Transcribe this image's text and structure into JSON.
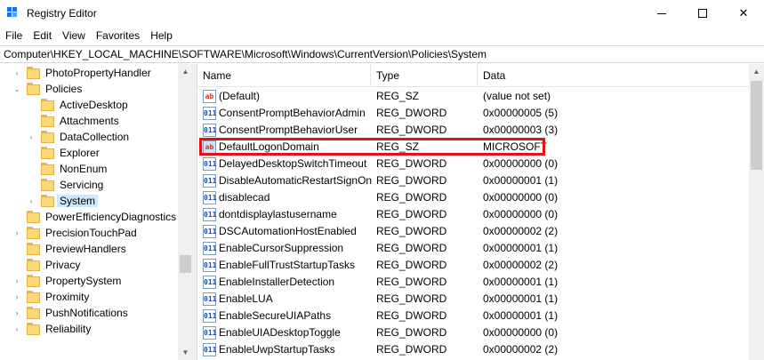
{
  "window": {
    "title": "Registry Editor",
    "minimize_icon": "minimize-icon",
    "maximize_icon": "maximize-icon",
    "close_glyph": "✕"
  },
  "menu": [
    "File",
    "Edit",
    "View",
    "Favorites",
    "Help"
  ],
  "address": "Computer\\HKEY_LOCAL_MACHINE\\SOFTWARE\\Microsoft\\Windows\\CurrentVersion\\Policies\\System",
  "tree": [
    {
      "label": "PhotoPropertyHandler",
      "level": 1,
      "expander": "›",
      "selected": false
    },
    {
      "label": "Policies",
      "level": 1,
      "expander": "⌄",
      "selected": false
    },
    {
      "label": "ActiveDesktop",
      "level": 2,
      "expander": "",
      "selected": false
    },
    {
      "label": "Attachments",
      "level": 2,
      "expander": "",
      "selected": false
    },
    {
      "label": "DataCollection",
      "level": 2,
      "expander": "›",
      "selected": false
    },
    {
      "label": "Explorer",
      "level": 2,
      "expander": "",
      "selected": false
    },
    {
      "label": "NonEnum",
      "level": 2,
      "expander": "",
      "selected": false
    },
    {
      "label": "Servicing",
      "level": 2,
      "expander": "",
      "selected": false
    },
    {
      "label": "System",
      "level": 2,
      "expander": "›",
      "selected": true
    },
    {
      "label": "PowerEfficiencyDiagnostics",
      "level": 1,
      "expander": "",
      "selected": false
    },
    {
      "label": "PrecisionTouchPad",
      "level": 1,
      "expander": "›",
      "selected": false
    },
    {
      "label": "PreviewHandlers",
      "level": 1,
      "expander": "",
      "selected": false
    },
    {
      "label": "Privacy",
      "level": 1,
      "expander": "",
      "selected": false
    },
    {
      "label": "PropertySystem",
      "level": 1,
      "expander": "›",
      "selected": false
    },
    {
      "label": "Proximity",
      "level": 1,
      "expander": "›",
      "selected": false
    },
    {
      "label": "PushNotifications",
      "level": 1,
      "expander": "›",
      "selected": false
    },
    {
      "label": "Reliability",
      "level": 1,
      "expander": "›",
      "selected": false
    }
  ],
  "columns": [
    "Name",
    "Type",
    "Data"
  ],
  "values": [
    {
      "name": "(Default)",
      "type": "REG_SZ",
      "data": "(value not set)",
      "icon": "ab"
    },
    {
      "name": "ConsentPromptBehaviorAdmin",
      "type": "REG_DWORD",
      "data": "0x00000005 (5)",
      "icon": "011"
    },
    {
      "name": "ConsentPromptBehaviorUser",
      "type": "REG_DWORD",
      "data": "0x00000003 (3)",
      "icon": "011"
    },
    {
      "name": "DefaultLogonDomain",
      "type": "REG_SZ",
      "data": "MICROSOFT",
      "icon": "ab",
      "highlighted": true
    },
    {
      "name": "DelayedDesktopSwitchTimeout",
      "type": "REG_DWORD",
      "data": "0x00000000 (0)",
      "icon": "011"
    },
    {
      "name": "DisableAutomaticRestartSignOn",
      "type": "REG_DWORD",
      "data": "0x00000001 (1)",
      "icon": "011"
    },
    {
      "name": "disablecad",
      "type": "REG_DWORD",
      "data": "0x00000000 (0)",
      "icon": "011"
    },
    {
      "name": "dontdisplaylastusername",
      "type": "REG_DWORD",
      "data": "0x00000000 (0)",
      "icon": "011"
    },
    {
      "name": "DSCAutomationHostEnabled",
      "type": "REG_DWORD",
      "data": "0x00000002 (2)",
      "icon": "011"
    },
    {
      "name": "EnableCursorSuppression",
      "type": "REG_DWORD",
      "data": "0x00000001 (1)",
      "icon": "011"
    },
    {
      "name": "EnableFullTrustStartupTasks",
      "type": "REG_DWORD",
      "data": "0x00000002 (2)",
      "icon": "011"
    },
    {
      "name": "EnableInstallerDetection",
      "type": "REG_DWORD",
      "data": "0x00000001 (1)",
      "icon": "011"
    },
    {
      "name": "EnableLUA",
      "type": "REG_DWORD",
      "data": "0x00000001 (1)",
      "icon": "011"
    },
    {
      "name": "EnableSecureUIAPaths",
      "type": "REG_DWORD",
      "data": "0x00000001 (1)",
      "icon": "011"
    },
    {
      "name": "EnableUIADesktopToggle",
      "type": "REG_DWORD",
      "data": "0x00000000 (0)",
      "icon": "011"
    },
    {
      "name": "EnableUwpStartupTasks",
      "type": "REG_DWORD",
      "data": "0x00000002 (2)",
      "icon": "011"
    }
  ],
  "colors": {
    "highlight_border": "#e0131a",
    "selection": "#cce8ff",
    "folder": "#f9d876"
  }
}
